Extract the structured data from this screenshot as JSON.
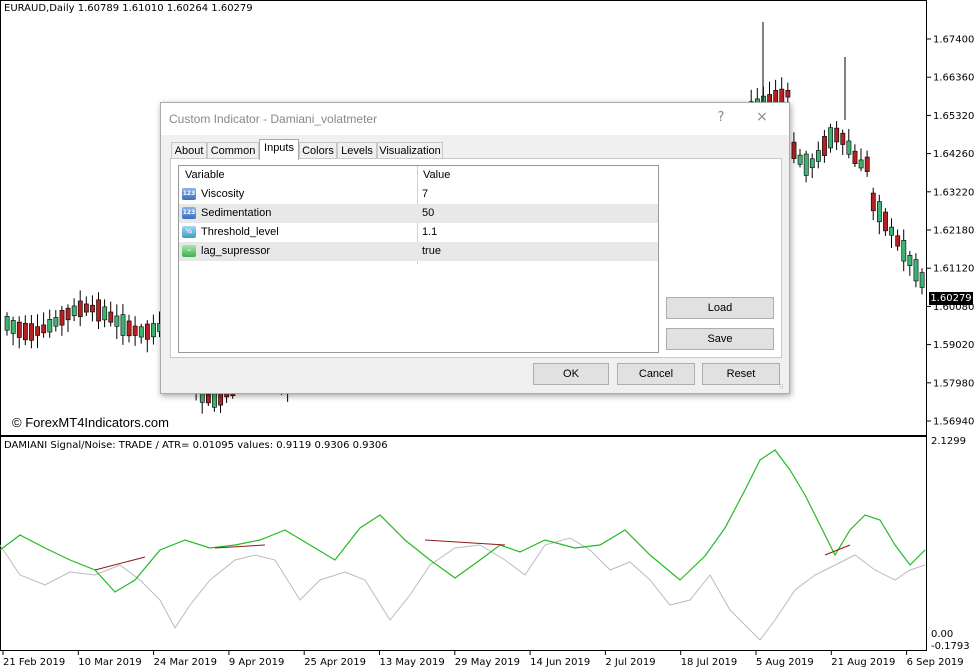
{
  "chart": {
    "symbol_label": "EURAUD,Daily  1.60789 1.61010 1.60264 1.60279",
    "watermark": "© ForexMT4Indicators.com",
    "indicator_label": "DAMIANI Signal/Noise: TRADE  /  ATR= 0.01095    values: 0.9119 0.9306 0.9306",
    "current_price": "1.60279",
    "price_axis": [
      "1.67400",
      "1.66360",
      "1.65320",
      "1.64260",
      "1.63220",
      "1.62180",
      "1.61120",
      "1.60080",
      "1.59020",
      "1.57980",
      "1.56940"
    ],
    "indicator_axis": [
      "2.1299",
      "0.00",
      "-0.1793"
    ],
    "date_axis": [
      "21 Feb 2019",
      "10 Mar 2019",
      "24 Mar 2019",
      "9 Apr 2019",
      "25 Apr 2019",
      "13 May 2019",
      "29 May 2019",
      "14 Jun 2019",
      "2 Jul 2019",
      "18 Jul 2019",
      "5 Aug 2019",
      "21 Aug 2019",
      "6 Sep 2019"
    ],
    "colors": {
      "bull": "#3cb371",
      "bear": "#b22222",
      "signal_line": "#22bb22",
      "noise_line": "#bbbbbb",
      "threshold_line": "#8b1a1a"
    }
  },
  "dialog": {
    "title": "Custom Indicator - Damiani_volatmeter",
    "help": "?",
    "close": "×",
    "tabs": [
      {
        "label": "About"
      },
      {
        "label": "Common"
      },
      {
        "label": "Inputs"
      },
      {
        "label": "Colors"
      },
      {
        "label": "Levels"
      },
      {
        "label": "Visualization"
      }
    ],
    "active_tab": "Inputs",
    "table": {
      "headers": {
        "variable": "Variable",
        "value": "Value"
      },
      "rows": [
        {
          "variable": "Viscosity",
          "value": "7",
          "icon": "int-type-icon",
          "icon_text": "123"
        },
        {
          "variable": "Sedimentation",
          "value": "50",
          "icon": "int-type-icon",
          "icon_text": "123"
        },
        {
          "variable": "Threshold_level",
          "value": "1.1",
          "icon": "double-type-icon",
          "icon_text": "½"
        },
        {
          "variable": "lag_supressor",
          "value": "true",
          "icon": "bool-type-icon",
          "icon_text": "~"
        }
      ]
    },
    "buttons": {
      "load": "Load",
      "save": "Save",
      "ok": "OK",
      "cancel": "Cancel",
      "reset": "Reset"
    }
  }
}
